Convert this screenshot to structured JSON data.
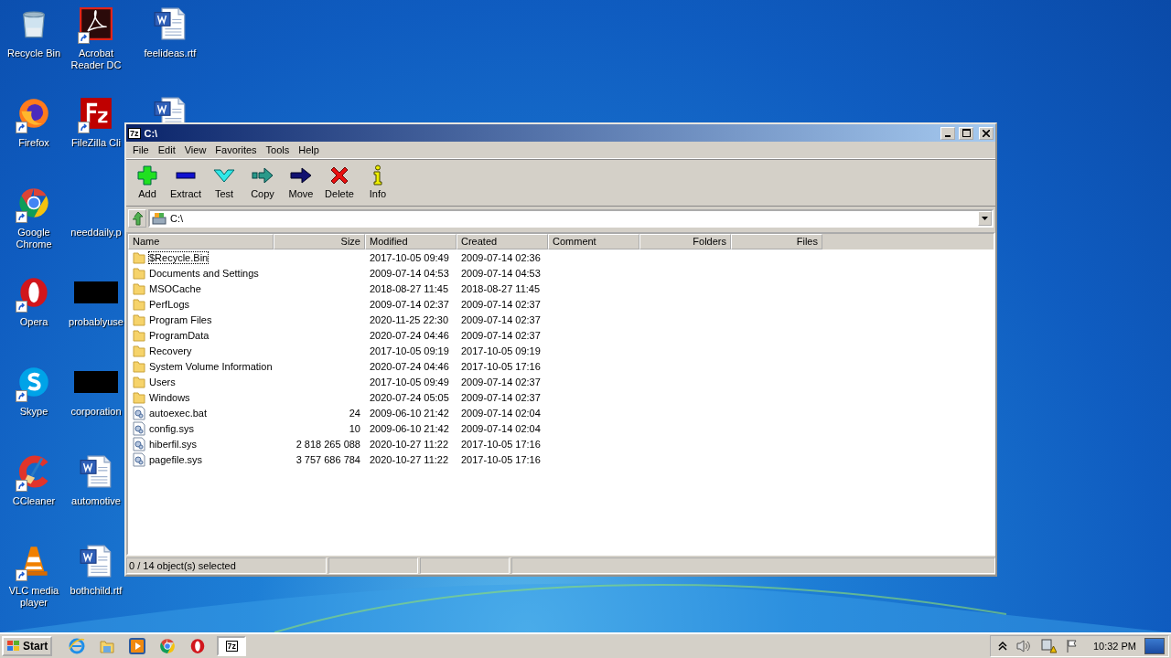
{
  "desktop_icons": [
    {
      "kind": "recycle",
      "label": "Recycle Bin",
      "shortcut": false
    },
    {
      "kind": "firefox",
      "label": "Firefox",
      "shortcut": true
    },
    {
      "kind": "chrome",
      "label": "Google Chrome",
      "shortcut": true
    },
    {
      "kind": "opera",
      "label": "Opera",
      "shortcut": true
    },
    {
      "kind": "skype",
      "label": "Skype",
      "shortcut": true
    },
    {
      "kind": "ccleaner",
      "label": "CCleaner",
      "shortcut": true
    },
    {
      "kind": "vlc",
      "label": "VLC media player",
      "shortcut": true
    },
    {
      "kind": "acrobat",
      "label": "Acrobat Reader DC",
      "shortcut": true
    },
    {
      "kind": "filezilla",
      "label": "FileZilla Cli",
      "shortcut": true
    },
    {
      "kind": "none",
      "label": "needdaily.p",
      "shortcut": false
    },
    {
      "kind": "dark",
      "label": "probablyuse",
      "shortcut": false
    },
    {
      "kind": "dark",
      "label": "corporation",
      "shortcut": false
    },
    {
      "kind": "word",
      "label": "automotive",
      "shortcut": false
    },
    {
      "kind": "word",
      "label": "bothchild.rtf",
      "shortcut": false
    },
    {
      "kind": "word",
      "label": "feelideas.rtf",
      "shortcut": false
    },
    {
      "kind": "word",
      "shortcut": false
    }
  ],
  "window": {
    "app_badge": "7z",
    "title": "C:\\",
    "menu": [
      "File",
      "Edit",
      "View",
      "Favorites",
      "Tools",
      "Help"
    ],
    "toolbar": [
      {
        "kind": "add",
        "label": "Add"
      },
      {
        "kind": "extract",
        "label": "Extract"
      },
      {
        "kind": "test",
        "label": "Test"
      },
      {
        "kind": "copy",
        "label": "Copy"
      },
      {
        "kind": "move",
        "label": "Move"
      },
      {
        "kind": "delete",
        "label": "Delete"
      },
      {
        "kind": "info",
        "label": "Info"
      }
    ],
    "address": "C:\\",
    "columns": [
      {
        "label": "Name",
        "kind": "text"
      },
      {
        "label": "Size",
        "kind": "number"
      },
      {
        "label": "Modified",
        "kind": "text"
      },
      {
        "label": "Created",
        "kind": "text"
      },
      {
        "label": "Comment",
        "kind": "text"
      },
      {
        "label": "Folders",
        "kind": "number"
      },
      {
        "label": "Files",
        "kind": "number"
      }
    ],
    "rows": [
      {
        "kind": "folder",
        "name": "$Recycle.Bin",
        "modified": "2017-10-05 09:49",
        "created": "2009-07-14 02:36",
        "focused": true
      },
      {
        "kind": "folder",
        "name": "Documents and Settings",
        "modified": "2009-07-14 04:53",
        "created": "2009-07-14 04:53",
        "focused": false
      },
      {
        "kind": "folder",
        "name": "MSOCache",
        "modified": "2018-08-27 11:45",
        "created": "2018-08-27 11:45",
        "focused": false
      },
      {
        "kind": "folder",
        "name": "PerfLogs",
        "modified": "2009-07-14 02:37",
        "created": "2009-07-14 02:37",
        "focused": false
      },
      {
        "kind": "folder",
        "name": "Program Files",
        "modified": "2020-11-25 22:30",
        "created": "2009-07-14 02:37",
        "focused": false
      },
      {
        "kind": "folder",
        "name": "ProgramData",
        "modified": "2020-07-24 04:46",
        "created": "2009-07-14 02:37",
        "focused": false
      },
      {
        "kind": "folder",
        "name": "Recovery",
        "modified": "2017-10-05 09:19",
        "created": "2017-10-05 09:19",
        "focused": false
      },
      {
        "kind": "folder",
        "name": "System Volume Information",
        "modified": "2020-07-24 04:46",
        "created": "2017-10-05 17:16",
        "focused": false
      },
      {
        "kind": "folder",
        "name": "Users",
        "modified": "2017-10-05 09:49",
        "created": "2009-07-14 02:37",
        "focused": false
      },
      {
        "kind": "folder",
        "name": "Windows",
        "modified": "2020-07-24 05:05",
        "created": "2009-07-14 02:37",
        "focused": false
      },
      {
        "kind": "file",
        "name": "autoexec.bat",
        "size": "24",
        "modified": "2009-06-10 21:42",
        "created": "2009-07-14 02:04",
        "focused": false
      },
      {
        "kind": "file",
        "name": "config.sys",
        "size": "10",
        "modified": "2009-06-10 21:42",
        "created": "2009-07-14 02:04",
        "focused": false
      },
      {
        "kind": "file",
        "name": "hiberfil.sys",
        "size": "2 818 265 088",
        "modified": "2020-10-27 11:22",
        "created": "2017-10-05 17:16",
        "focused": false
      },
      {
        "kind": "file",
        "name": "pagefile.sys",
        "size": "3 757 686 784",
        "modified": "2020-10-27 11:22",
        "created": "2017-10-05 17:16",
        "focused": false
      }
    ],
    "status": "0 / 14 object(s) selected"
  },
  "taskbar": {
    "start": "Start",
    "quick_launch": [
      {
        "kind": "ie"
      },
      {
        "kind": "explorer"
      },
      {
        "kind": "media"
      },
      {
        "kind": "chrome"
      },
      {
        "kind": "opera"
      }
    ],
    "tasks": [
      {
        "badge": "7z",
        "active": true
      }
    ],
    "tray": [
      {
        "kind": "chevron"
      },
      {
        "kind": "speaker"
      },
      {
        "kind": "network"
      },
      {
        "kind": "flag"
      }
    ],
    "clock": "10:32 PM"
  }
}
